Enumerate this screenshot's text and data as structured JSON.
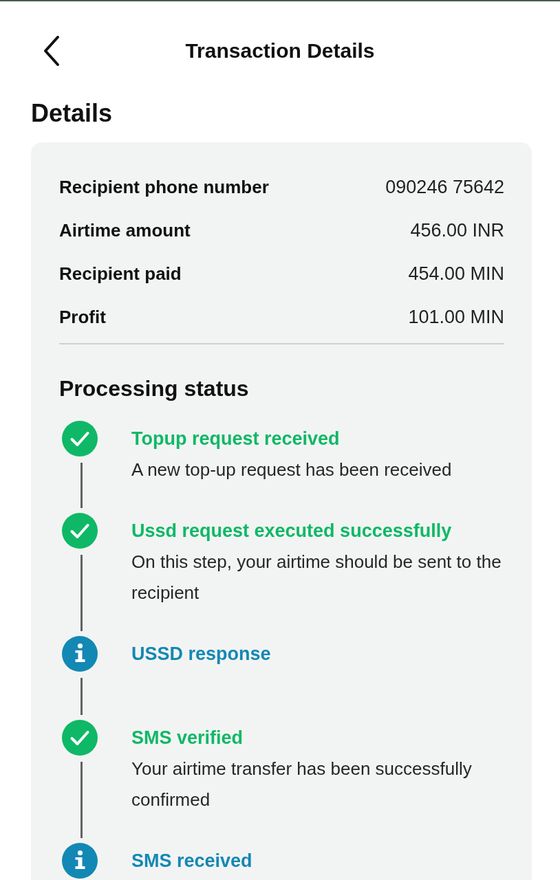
{
  "header": {
    "title": "Transaction Details"
  },
  "details_section": {
    "title": "Details",
    "rows": [
      {
        "label": "Recipient phone number",
        "value": "090246 75642"
      },
      {
        "label": "Airtime amount",
        "value": "456.00 INR"
      },
      {
        "label": "Recipient paid",
        "value": "454.00 MIN"
      },
      {
        "label": "Profit",
        "value": "101.00 MIN"
      }
    ]
  },
  "processing": {
    "title": "Processing status",
    "steps": [
      {
        "kind": "done",
        "title": "Topup request received",
        "description": "A new top-up request has been received"
      },
      {
        "kind": "done",
        "title": "Ussd request executed successfully",
        "description": "On this step, your airtime should be sent to the recipient"
      },
      {
        "kind": "info",
        "title": "USSD response"
      },
      {
        "kind": "done",
        "title": "SMS verified",
        "description": "Your airtime transfer has been successfully confirmed"
      },
      {
        "kind": "info",
        "title": "SMS received"
      }
    ]
  }
}
